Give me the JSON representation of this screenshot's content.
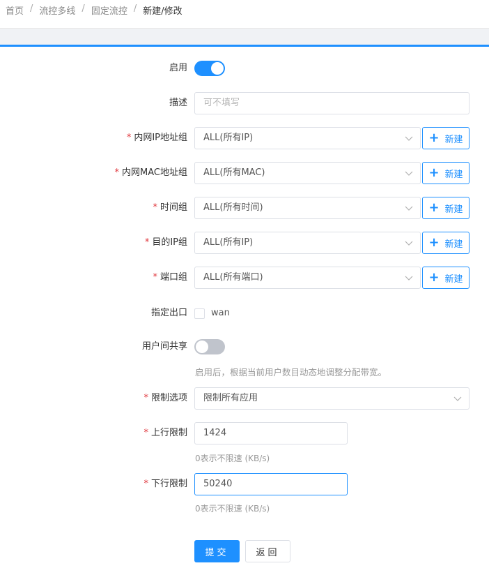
{
  "breadcrumb": {
    "items": [
      "首页",
      "流控多线",
      "固定流控"
    ],
    "current": "新建/修改",
    "separator": "/"
  },
  "form": {
    "enable": {
      "label": "启用",
      "on": true
    },
    "desc": {
      "label": "描述",
      "placeholder": "可不填写"
    },
    "lan_ip_group": {
      "label": "内网IP地址组",
      "value": "ALL(所有IP)",
      "required": true
    },
    "lan_mac_group": {
      "label": "内网MAC地址组",
      "value": "ALL(所有MAC)",
      "required": true
    },
    "time_group": {
      "label": "时间组",
      "value": "ALL(所有时间)",
      "required": true
    },
    "dst_ip_group": {
      "label": "目的IP组",
      "value": "ALL(所有IP)",
      "required": true
    },
    "port_group": {
      "label": "端口组",
      "value": "ALL(所有端口)",
      "required": true
    },
    "new_label": "新建",
    "exit": {
      "label": "指定出口",
      "option": "wan",
      "checked": false
    },
    "share": {
      "label": "用户间共享",
      "on": false,
      "hint": "启用后，根据当前用户数目动态地调整分配带宽。"
    },
    "limit_option": {
      "label": "限制选项",
      "value": "限制所有应用",
      "required": true
    },
    "upload": {
      "label": "上行限制",
      "value": "1424",
      "hint": "0表示不限速 (KB/s)",
      "required": true
    },
    "download": {
      "label": "下行限制",
      "value": "50240",
      "hint": "0表示不限速 (KB/s)",
      "required": true
    },
    "required_mark": "*"
  },
  "actions": {
    "submit": "提交",
    "back": "返回"
  },
  "colors": {
    "accent": "#1e90ff",
    "required": "#e0383e"
  }
}
